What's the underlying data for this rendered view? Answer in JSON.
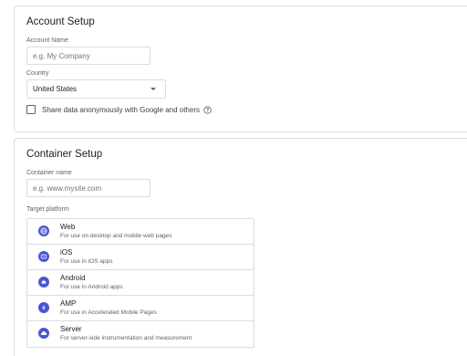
{
  "account_setup": {
    "title": "Account Setup",
    "account_name_label": "Account Name",
    "account_name_placeholder": "e.g. My Company",
    "country_label": "Country",
    "country_value": "United States",
    "share_data_label": "Share data anonymously with Google and others"
  },
  "container_setup": {
    "title": "Container Setup",
    "container_name_label": "Container name",
    "container_name_placeholder": "e.g. www.mysite.com",
    "target_platform_label": "Target platform",
    "platforms": [
      {
        "name": "Web",
        "description": "For use on desktop and mobile web pages",
        "icon": "globe-icon"
      },
      {
        "name": "iOS",
        "description": "For use in iOS apps",
        "icon": "ios-icon"
      },
      {
        "name": "Android",
        "description": "For use in Android apps",
        "icon": "android-icon"
      },
      {
        "name": "AMP",
        "description": "For use in Accelerated Mobile Pages",
        "icon": "amp-bolt-icon"
      },
      {
        "name": "Server",
        "description": "For server-side instrumentation and measurement",
        "icon": "cloud-icon"
      }
    ]
  },
  "colors": {
    "platform_icon": "#4a55d6",
    "border": "#dadce0"
  }
}
